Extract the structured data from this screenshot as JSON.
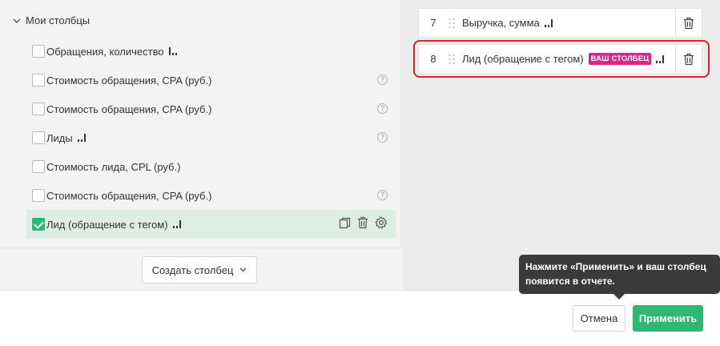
{
  "columns_group": {
    "title": "Мои столбцы",
    "items": [
      {
        "label": "Обращения, количество",
        "checked": false,
        "has_bars": true,
        "has_help": false
      },
      {
        "label": "Стоимость обращения, CPA (руб.)",
        "checked": false,
        "has_bars": false,
        "has_help": true
      },
      {
        "label": "Стоимость обращения, CPA (руб.)",
        "checked": false,
        "has_bars": false,
        "has_help": true
      },
      {
        "label": "Лиды",
        "checked": false,
        "has_bars": true,
        "has_help": true
      },
      {
        "label": "Стоимость лида, CPL (руб.)",
        "checked": false,
        "has_bars": false,
        "has_help": false
      },
      {
        "label": "Стоимость обращения, CPA (руб.)",
        "checked": false,
        "has_bars": false,
        "has_help": true
      },
      {
        "label": "Лид (обращение с тегом)",
        "checked": true,
        "has_bars": true,
        "has_help": false
      }
    ],
    "help_glyph": "?",
    "create_button_label": "Создать столбец"
  },
  "selected_columns": [
    {
      "number": "7",
      "label": "Выручка, сумма",
      "badge": ""
    },
    {
      "number": "8",
      "label": "Лид (обращение с тегом)",
      "badge": "ВАШ СТОЛБЕЦ"
    }
  ],
  "footer": {
    "cancel_label": "Отмена",
    "apply_label": "Применить"
  },
  "tooltip": {
    "text": "Нажмите «Применить» и ваш столбец появится в отчете."
  },
  "colors": {
    "accent_green": "#2eb872",
    "badge_pink": "#d9248a",
    "highlight_red": "#d9232b",
    "tooltip_bg": "#3a3a3a"
  },
  "icons": [
    "chevron-down-icon",
    "bars-icon",
    "help-icon",
    "copy-icon",
    "trash-icon",
    "gear-icon",
    "drag-handle-icon"
  ]
}
